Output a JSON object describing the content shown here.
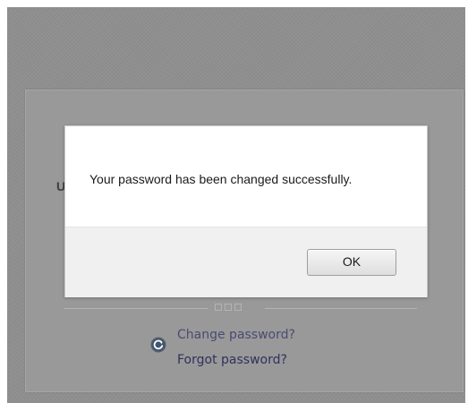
{
  "background_form": {
    "partial_label": "U",
    "links": {
      "change_password": "Change password?",
      "forgot_password": "Forgot password?"
    }
  },
  "dialog": {
    "message": "Your password has been changed successfully.",
    "ok_label": "OK"
  },
  "icons": {
    "refresh": "refresh-icon"
  },
  "colors": {
    "overlay": "#8f8f8f",
    "link": "#3a3a7a",
    "dialog_footer": "#f0f0f0"
  }
}
